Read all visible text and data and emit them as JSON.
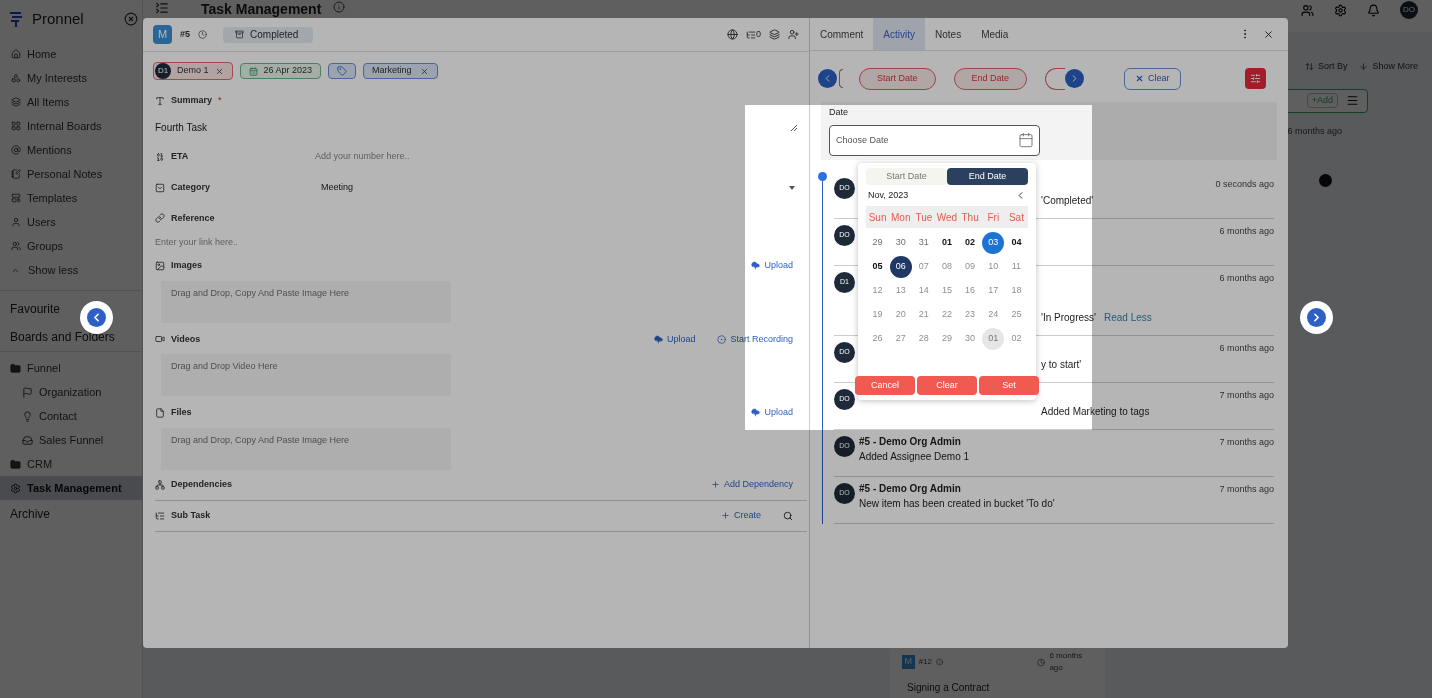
{
  "app": {
    "logo": "Pronnel",
    "page_title": "Task Management",
    "user_initials": "DO"
  },
  "sidebar": {
    "items": [
      {
        "label": "Home"
      },
      {
        "label": "My Interests"
      },
      {
        "label": "All Items"
      },
      {
        "label": "Internal Boards"
      },
      {
        "label": "Mentions"
      },
      {
        "label": "Personal Notes"
      },
      {
        "label": "Templates"
      },
      {
        "label": "Users"
      },
      {
        "label": "Groups"
      }
    ],
    "toggle": "Show less",
    "favourite": "Favourite",
    "boards_heading": "Boards and Folders",
    "tree": [
      {
        "label": "Funnel",
        "selected": false,
        "children": [
          {
            "label": "Organization",
            "selected": false
          },
          {
            "label": "Contact",
            "selected": false
          },
          {
            "label": "Sales Funnel",
            "selected": false
          }
        ]
      },
      {
        "label": "CRM",
        "selected": false
      },
      {
        "label": "Task Management",
        "selected": true
      }
    ],
    "archive": "Archive"
  },
  "board": {
    "sort": "Sort By",
    "show_more": "Show More",
    "add": "+Add",
    "time": "6 months ago",
    "card": {
      "avatar": "M",
      "id": "#12",
      "time": "6 months ago",
      "title": "Signing a Contract"
    }
  },
  "task": {
    "avatar": "M",
    "id": "#5",
    "status": "Completed",
    "subtask_count": "0",
    "chips": [
      {
        "kind": "assignee",
        "avatar": "D1",
        "label": "Demo 1"
      },
      {
        "kind": "date",
        "label": "26 Apr 2023"
      },
      {
        "kind": "tag-add"
      },
      {
        "kind": "tag",
        "label": "Marketing"
      }
    ],
    "fields": [
      {
        "kind": "text",
        "label": "Summary",
        "required_mark": "*",
        "value": "Fourth Task"
      },
      {
        "kind": "number",
        "label": "ETA",
        "placeholder": "Add your number here.."
      },
      {
        "kind": "select",
        "label": "Category",
        "value": "Meeting"
      },
      {
        "kind": "link",
        "label": "Reference",
        "placeholder": "Enter your link here.."
      },
      {
        "kind": "media",
        "label": "Images",
        "actions": [
          {
            "kind": "upload",
            "label": "Upload"
          }
        ],
        "drop": "Drag and Drop, Copy And Paste Image Here"
      },
      {
        "kind": "media",
        "label": "Videos",
        "actions": [
          {
            "kind": "upload",
            "label": "Upload"
          },
          {
            "kind": "record",
            "label": "Start Recording"
          }
        ],
        "drop": "Drag and Drop Video Here"
      },
      {
        "kind": "media",
        "label": "Files",
        "actions": [
          {
            "kind": "upload",
            "label": "Upload"
          }
        ],
        "drop": "Drag and Drop, Copy And Paste Image Here"
      },
      {
        "kind": "section",
        "label": "Dependencies",
        "actions": [
          {
            "kind": "add",
            "label": "Add Dependency"
          }
        ]
      },
      {
        "kind": "section",
        "label": "Sub Task",
        "actions": [
          {
            "kind": "add",
            "label": "Create"
          }
        ],
        "search": true
      }
    ]
  },
  "panel": {
    "tabs": [
      {
        "label": "Comment",
        "selected": false
      },
      {
        "label": "Activity",
        "selected": true
      },
      {
        "label": "Notes",
        "selected": false
      },
      {
        "label": "Media",
        "selected": false
      }
    ],
    "filters": [
      {
        "label": "Start Date"
      },
      {
        "label": "End Date"
      }
    ],
    "clear": "Clear",
    "date_filter": {
      "label": "Date",
      "placeholder": "Choose Date"
    },
    "datepicker": {
      "tabs": [
        {
          "label": "Start Date",
          "selected": false
        },
        {
          "label": "End Date",
          "selected": true
        }
      ],
      "month": "Nov, 2023",
      "weekdays": [
        "Sun",
        "Mon",
        "Tue",
        "Wed",
        "Thu",
        "Fri",
        "Sat"
      ],
      "days": [
        {
          "label": "29",
          "kind": "outside"
        },
        {
          "label": "30",
          "kind": "outside"
        },
        {
          "label": "31",
          "kind": "outside"
        },
        {
          "label": "01",
          "kind": "normal"
        },
        {
          "label": "02",
          "kind": "normal"
        },
        {
          "label": "03",
          "kind": "start"
        },
        {
          "label": "04",
          "kind": "normal"
        },
        {
          "label": "05",
          "kind": "normal"
        },
        {
          "label": "06",
          "kind": "end"
        },
        {
          "label": "07",
          "kind": "disabled"
        },
        {
          "label": "08",
          "kind": "disabled"
        },
        {
          "label": "09",
          "kind": "disabled"
        },
        {
          "label": "10",
          "kind": "disabled"
        },
        {
          "label": "11",
          "kind": "disabled"
        },
        {
          "label": "12",
          "kind": "disabled"
        },
        {
          "label": "13",
          "kind": "disabled"
        },
        {
          "label": "14",
          "kind": "disabled"
        },
        {
          "label": "15",
          "kind": "disabled"
        },
        {
          "label": "16",
          "kind": "disabled"
        },
        {
          "label": "17",
          "kind": "disabled"
        },
        {
          "label": "18",
          "kind": "disabled"
        },
        {
          "label": "19",
          "kind": "disabled"
        },
        {
          "label": "20",
          "kind": "disabled"
        },
        {
          "label": "21",
          "kind": "disabled"
        },
        {
          "label": "22",
          "kind": "disabled"
        },
        {
          "label": "23",
          "kind": "disabled"
        },
        {
          "label": "24",
          "kind": "disabled"
        },
        {
          "label": "25",
          "kind": "disabled"
        },
        {
          "label": "26",
          "kind": "disabled"
        },
        {
          "label": "27",
          "kind": "disabled"
        },
        {
          "label": "28",
          "kind": "disabled"
        },
        {
          "label": "29",
          "kind": "disabled"
        },
        {
          "label": "30",
          "kind": "disabled"
        },
        {
          "label": "01",
          "kind": "hover"
        },
        {
          "label": "02",
          "kind": "disabled"
        }
      ],
      "buttons": [
        "Cancel",
        "Clear",
        "Set"
      ]
    },
    "activity": [
      {
        "avatar": "DO",
        "text": "'Completed'",
        "time": "0 seconds ago",
        "covered": true
      },
      {
        "avatar": "DO",
        "time": "6 months ago",
        "covered": true
      },
      {
        "avatar": "D1",
        "text": "'In Progress'",
        "link": "Read Less",
        "time": "6 months ago",
        "covered": true
      },
      {
        "avatar": "DO",
        "text": "y to start'",
        "time": "6 months ago",
        "covered": true
      },
      {
        "avatar": "DO",
        "text": "Added Marketing to tags",
        "time": "7 months ago",
        "covered": true
      },
      {
        "avatar": "DO",
        "title": "#5 - Demo Org Admin",
        "text": "Added Assignee Demo 1",
        "time": "7 months ago",
        "covered": false
      },
      {
        "avatar": "DO",
        "title": "#5 - Demo Org Admin",
        "text": "New item has been created in bucket 'To do'",
        "time": "7 months ago",
        "covered": false
      }
    ]
  }
}
